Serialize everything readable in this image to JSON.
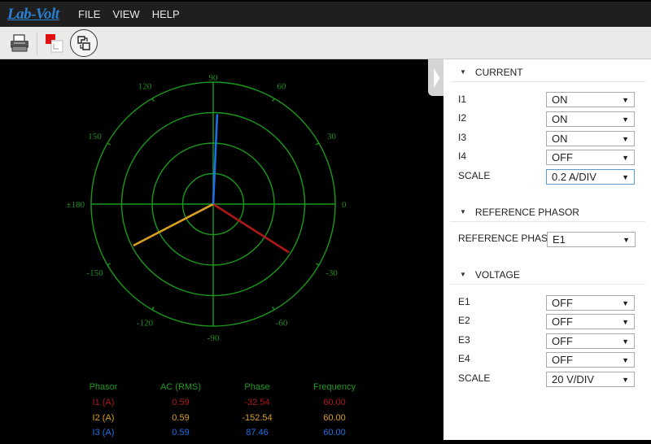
{
  "app": {
    "logo_text": "Lab-Volt",
    "menu": [
      "FILE",
      "VIEW",
      "HELP"
    ]
  },
  "toolbar": {
    "icons": [
      "print-icon",
      "overlay-icon",
      "swap-phasor-icon"
    ]
  },
  "colors": {
    "grid": "#1a9a1a",
    "label": "#1f8f1f",
    "i1": "#b01818",
    "i2": "#d9a020",
    "i3": "#1e6fe6"
  },
  "chart_data": {
    "type": "polar-phasor",
    "angle_labels": [
      {
        "angle": 0,
        "text": "0"
      },
      {
        "angle": 30,
        "text": "30"
      },
      {
        "angle": 60,
        "text": "60"
      },
      {
        "angle": 90,
        "text": "90"
      },
      {
        "angle": 120,
        "text": "120"
      },
      {
        "angle": 150,
        "text": "150"
      },
      {
        "angle": 180,
        "text": "±180"
      },
      {
        "angle": -150,
        "text": "-150"
      },
      {
        "angle": -120,
        "text": "-120"
      },
      {
        "angle": -90,
        "text": "-90"
      },
      {
        "angle": -60,
        "text": "-60"
      },
      {
        "angle": -30,
        "text": "-30"
      }
    ],
    "rings": 4,
    "scale_per_div": 0.2,
    "phasors": [
      {
        "name": "I1 (A)",
        "magnitude": 0.59,
        "phase": -32.54,
        "color_key": "i1"
      },
      {
        "name": "I2 (A)",
        "magnitude": 0.59,
        "phase": -152.54,
        "color_key": "i2"
      },
      {
        "name": "I3 (A)",
        "magnitude": 0.59,
        "phase": 87.46,
        "color_key": "i3"
      }
    ]
  },
  "table": {
    "headers": [
      "Phasor",
      "AC (RMS)",
      "Phase",
      "Frequency"
    ],
    "rows": [
      {
        "phasor": "I1 (A)",
        "rms": "0.59",
        "phase": "-32.54",
        "freq": "60.00",
        "color_key": "i1"
      },
      {
        "phasor": "I2 (A)",
        "rms": "0.59",
        "phase": "-152.54",
        "freq": "60.00",
        "color_key": "i2"
      },
      {
        "phasor": "I3 (A)",
        "rms": "0.59",
        "phase": "87.46",
        "freq": "60.00",
        "color_key": "i3"
      }
    ]
  },
  "panel": {
    "current": {
      "title": "CURRENT",
      "rows": [
        {
          "label": "I1",
          "value": "ON"
        },
        {
          "label": "I2",
          "value": "ON"
        },
        {
          "label": "I3",
          "value": "ON"
        },
        {
          "label": "I4",
          "value": "OFF"
        },
        {
          "label": "SCALE",
          "value": "0.2 A/DIV"
        }
      ]
    },
    "reference": {
      "title": "REFERENCE PHASOR",
      "label": "REFERENCE PHASOR",
      "value": "E1"
    },
    "voltage": {
      "title": "VOLTAGE",
      "rows": [
        {
          "label": "E1",
          "value": "OFF"
        },
        {
          "label": "E2",
          "value": "OFF"
        },
        {
          "label": "E3",
          "value": "OFF"
        },
        {
          "label": "E4",
          "value": "OFF"
        },
        {
          "label": "SCALE",
          "value": "20 V/DIV"
        }
      ]
    }
  }
}
